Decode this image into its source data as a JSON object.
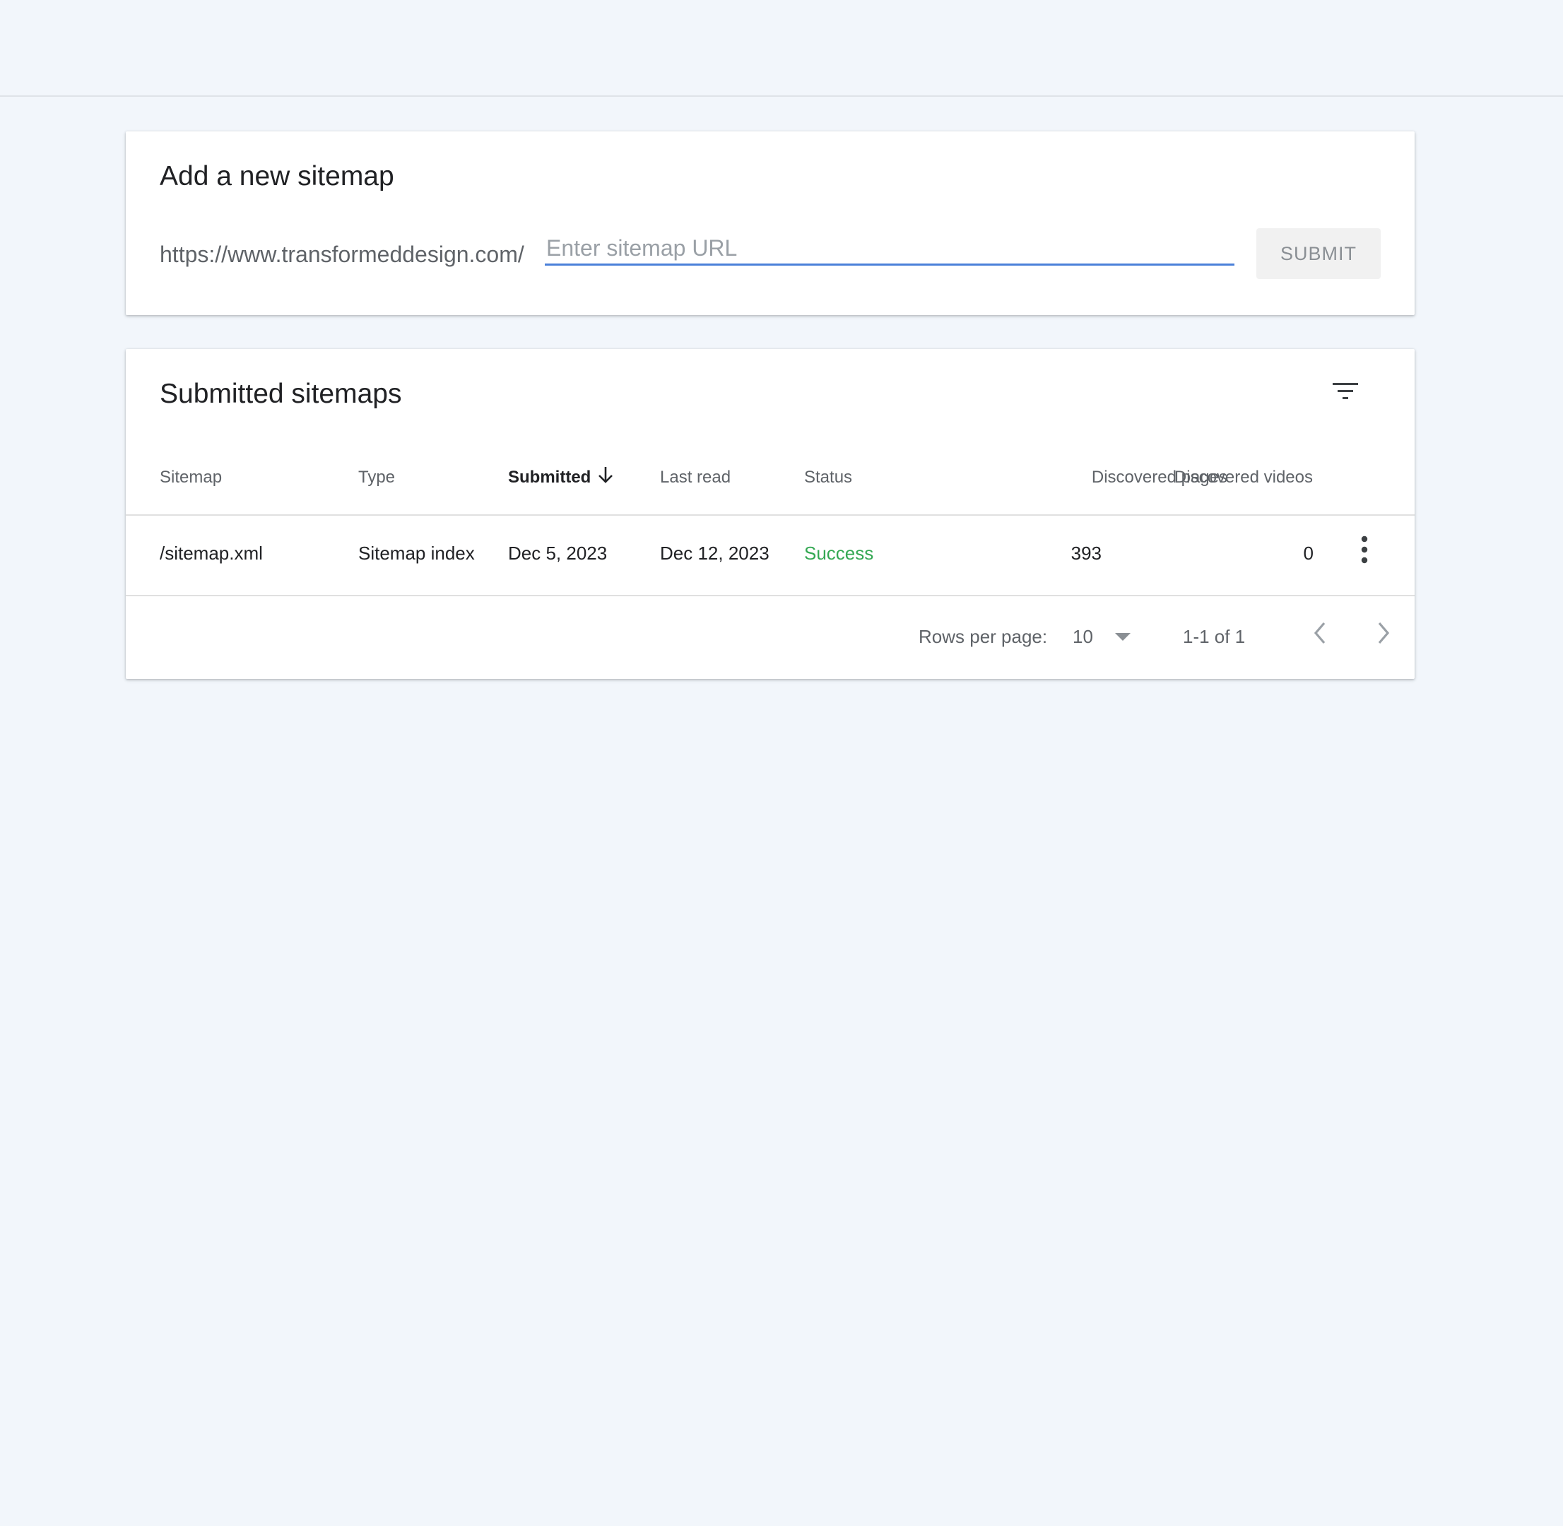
{
  "add_card": {
    "title": "Add a new sitemap",
    "url_prefix": "https://www.transformeddesign.com/",
    "input_placeholder": "Enter sitemap URL",
    "input_value": "",
    "submit_label": "SUBMIT"
  },
  "list_card": {
    "title": "Submitted sitemaps",
    "filter_icon": "filter-list-icon",
    "columns": {
      "sitemap": "Sitemap",
      "type": "Type",
      "submitted": "Submitted",
      "last_read": "Last read",
      "status": "Status",
      "discovered_pages": "Discovered pages",
      "discovered_videos": "Discovered videos"
    },
    "sort_icon": "arrow-downward-icon",
    "rows": [
      {
        "sitemap": "/sitemap.xml",
        "type": "Sitemap index",
        "submitted": "Dec 5, 2023",
        "last_read": "Dec 12, 2023",
        "status": "Success",
        "discovered_pages": "393",
        "discovered_videos": "0"
      }
    ],
    "pagination": {
      "rows_per_page_label": "Rows per page:",
      "rows_per_page_value": "10",
      "range": "1-1 of 1"
    }
  },
  "colors": {
    "background": "#f2f6fb",
    "input_underline": "#4a80d9",
    "success": "#34a853"
  }
}
